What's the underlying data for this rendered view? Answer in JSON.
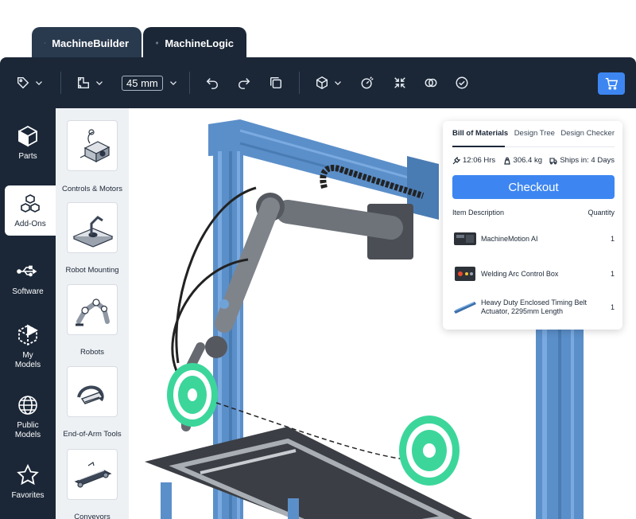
{
  "tabs": [
    {
      "label": "MachineBuilder",
      "icon": "cube-icon",
      "active": true
    },
    {
      "label": "MachineLogic",
      "icon": "cube-icon",
      "active": false
    }
  ],
  "toolbar": {
    "size_value": "45 mm",
    "icons": [
      "tag-icon",
      "ruler-icon",
      "undo-icon",
      "redo-icon",
      "duplicate-icon",
      "view-cube-icon",
      "measure-icon",
      "collapse-icon",
      "overlap-icon",
      "check-circle-icon",
      "cart-icon"
    ],
    "accent": "#3d86f2"
  },
  "sidebar": {
    "items": [
      {
        "label": "Parts",
        "icon": "cube-icon"
      },
      {
        "label": "Add-Ons",
        "icon": "stacked-boxes-icon",
        "active": true
      },
      {
        "label": "Software",
        "icon": "usb-icon"
      },
      {
        "label": "My Models",
        "icon": "dashed-cube-icon"
      },
      {
        "label": "Public Models",
        "icon": "globe-icon"
      },
      {
        "label": "Favorites",
        "icon": "star-icon"
      }
    ]
  },
  "addons": {
    "items": [
      {
        "label": "Controls & Motors",
        "icon": "controls-motors-icon"
      },
      {
        "label": "Robot Mounting",
        "icon": "robot-mounting-icon"
      },
      {
        "label": "Robots",
        "icon": "robot-arm-icon"
      },
      {
        "label": "End-of-Arm Tools",
        "icon": "gripper-icon"
      },
      {
        "label": "Conveyors",
        "icon": "conveyor-icon"
      }
    ]
  },
  "bom": {
    "tabs": [
      "Bill of Materials",
      "Design Tree",
      "Design Checker"
    ],
    "stats": {
      "time": "12:06 Hrs",
      "weight": "306.4 kg",
      "ships": "Ships in: 4 Days"
    },
    "checkout_label": "Checkout",
    "headers": {
      "item": "Item Description",
      "qty": "Quantity"
    },
    "items": [
      {
        "desc": "MachineMotion AI",
        "qty": "1",
        "icon": "controller-box-icon"
      },
      {
        "desc": "Welding Arc Control Box",
        "qty": "1",
        "icon": "control-box-icon"
      },
      {
        "desc": "Heavy Duty Enclosed Timing Belt Actuator, 2295mm Length",
        "qty": "1",
        "icon": "actuator-icon"
      }
    ]
  },
  "scene": {
    "frame_color": "#5b8fc9",
    "target_color": "#3cd69b"
  }
}
